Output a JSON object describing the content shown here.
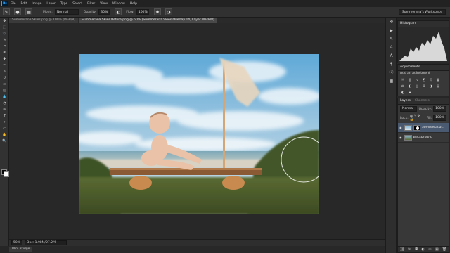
{
  "menubar": {
    "logo": "Ps",
    "items": [
      "File",
      "Edit",
      "Image",
      "Layer",
      "Type",
      "Select",
      "Filter",
      "View",
      "Window",
      "Help"
    ]
  },
  "options": {
    "mode_label": "Mode:",
    "mode_value": "Normal",
    "opacity_label": "Opacity:",
    "opacity_value": "30%",
    "flow_label": "Flow:",
    "flow_value": "100%",
    "workspace": "Summerana's Workspace"
  },
  "tabs": [
    "Summerana Skies.png @ 100% (RGB/8)",
    "Summerana Skies Before.png @ 50% (Summerana Skies Overlay 14, Layer Mask/8)"
  ],
  "status": {
    "zoom": "50%",
    "doc": "Doc: 1.98M/27.2M"
  },
  "bottom_tab": "Mini Bridge",
  "panels": {
    "histogram_title": "Histogram",
    "adjustments_title": "Adjustments",
    "adjustments_sub": "Add an adjustment",
    "layers_title": "Layers",
    "layers_sub": "Channels",
    "blend_mode": "Normal",
    "opacity_label": "Opacity:",
    "opacity_value": "100%",
    "lock_label": "Lock:",
    "fill_label": "Fill:",
    "fill_value": "100%",
    "layers": [
      {
        "name": "Summerana...",
        "selected": true
      },
      {
        "name": "Background",
        "selected": false
      }
    ]
  },
  "colors": {
    "accent": "#31a8ff",
    "panel": "#383838",
    "canvas_bg": "#282828"
  },
  "icons": {
    "tools": [
      "move-icon",
      "marquee-icon",
      "lasso-icon",
      "quick-select-icon",
      "crop-icon",
      "eyedropper-icon",
      "healing-icon",
      "brush-icon",
      "clone-stamp-icon",
      "history-brush-icon",
      "eraser-icon",
      "gradient-icon",
      "blur-icon",
      "dodge-icon",
      "pen-icon",
      "type-icon",
      "path-select-icon",
      "shape-icon",
      "hand-icon",
      "zoom-icon"
    ]
  }
}
